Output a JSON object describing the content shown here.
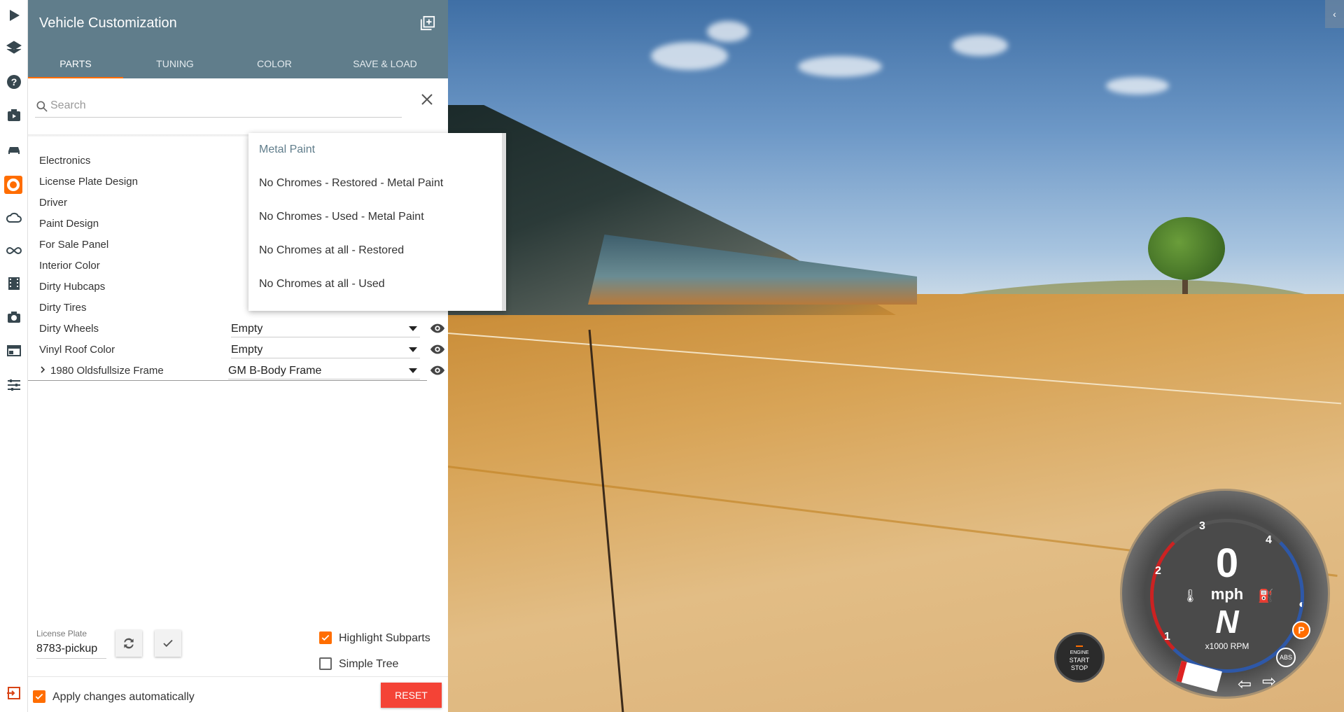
{
  "window": {
    "title": "Vehicle Customization"
  },
  "tabs": [
    {
      "label": "PARTS"
    },
    {
      "label": "TUNING"
    },
    {
      "label": "COLOR"
    },
    {
      "label": "SAVE & LOAD"
    }
  ],
  "search": {
    "placeholder": "Search",
    "value": ""
  },
  "parts": [
    {
      "label": "Electronics",
      "value": ""
    },
    {
      "label": "License Plate Design",
      "value": ""
    },
    {
      "label": "Driver",
      "value": ""
    },
    {
      "label": "Paint Design",
      "value": ""
    },
    {
      "label": "For Sale Panel",
      "value": ""
    },
    {
      "label": "Interior Color",
      "value": ""
    },
    {
      "label": "Dirty Hubcaps",
      "value": ""
    },
    {
      "label": "Dirty Tires",
      "value": ""
    },
    {
      "label": "Dirty Wheels",
      "value": "Empty"
    },
    {
      "label": "Vinyl Roof Color",
      "value": "Empty"
    },
    {
      "label": "1980 Oldsfullsize Frame",
      "value": "GM B-Body Frame"
    }
  ],
  "dropdown": {
    "options": [
      "Metal Paint",
      "No Chromes - Restored - Metal Paint",
      "No Chromes - Used - Metal Paint",
      "No Chromes at all - Restored",
      "No Chromes at all - Used"
    ]
  },
  "license_plate": {
    "label": "License Plate",
    "value": "8783-pickup"
  },
  "options": {
    "highlight_subparts": {
      "label": "Highlight Subparts",
      "checked": true
    },
    "simple_tree": {
      "label": "Simple Tree",
      "checked": false
    },
    "apply_auto": {
      "label": "Apply changes automatically",
      "checked": true
    }
  },
  "reset_label": "RESET",
  "hud": {
    "speed": "0",
    "speed_unit": "mph",
    "gear": "N",
    "rpm_unit": "x1000 RPM",
    "rpm_ticks": [
      "1",
      "2",
      "3",
      "4"
    ],
    "start_button": {
      "line1": "ENGINE",
      "line2": "START",
      "line3": "STOP"
    },
    "abs_label": "ABS",
    "parking_label": "P"
  },
  "colors": {
    "accent": "#ff6d00",
    "header": "#607d8b",
    "reset": "#f44336"
  }
}
